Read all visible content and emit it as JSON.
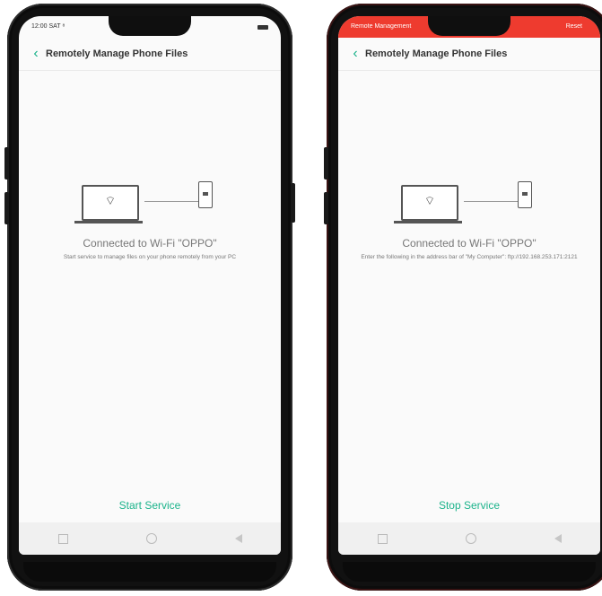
{
  "left_phone": {
    "status_time": "12:00 SAT ⁸",
    "title": "Remotely Manage Phone Files",
    "back_icon": "chevron-left-icon",
    "connected_text": "Connected to Wi-Fi \"OPPO\"",
    "description": "Start service to manage files on your phone remotely from your PC",
    "action_label": "Start Service"
  },
  "right_phone": {
    "status_left": "Remote Management",
    "status_right": "Reset",
    "title": "Remotely Manage Phone Files",
    "back_icon": "chevron-left-icon",
    "connected_text": "Connected to Wi-Fi \"OPPO\"",
    "description": "Enter the following in the address bar of \"My Computer\": ftp://192.168.253.171:2121",
    "action_label": "Stop Service"
  },
  "colors": {
    "accent": "#1cb38b",
    "status_red": "#ee3b2f"
  }
}
